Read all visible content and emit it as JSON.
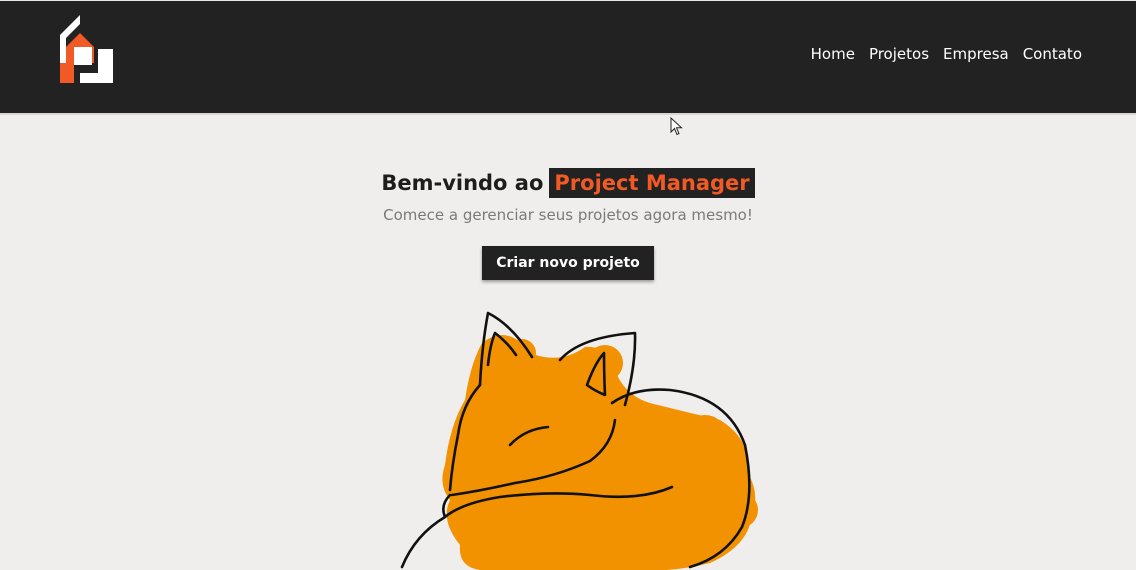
{
  "header": {
    "logo_icon": "house-logo-icon",
    "nav": {
      "items": [
        {
          "label": "Home"
        },
        {
          "label": "Projetos"
        },
        {
          "label": "Empresa"
        },
        {
          "label": "Contato"
        }
      ]
    }
  },
  "hero": {
    "title_prefix": "Bem-vindo ao",
    "title_highlight": "Project Manager",
    "subtitle": "Comece a gerenciar seus projetos agora mesmo!",
    "cta_label": "Criar novo projeto",
    "illustration_icon": "sleeping-fox-icon"
  },
  "colors": {
    "navbar_bg": "#222222",
    "page_bg": "#efeeec",
    "accent": "#f15a24",
    "fox_fill": "#f39200"
  }
}
